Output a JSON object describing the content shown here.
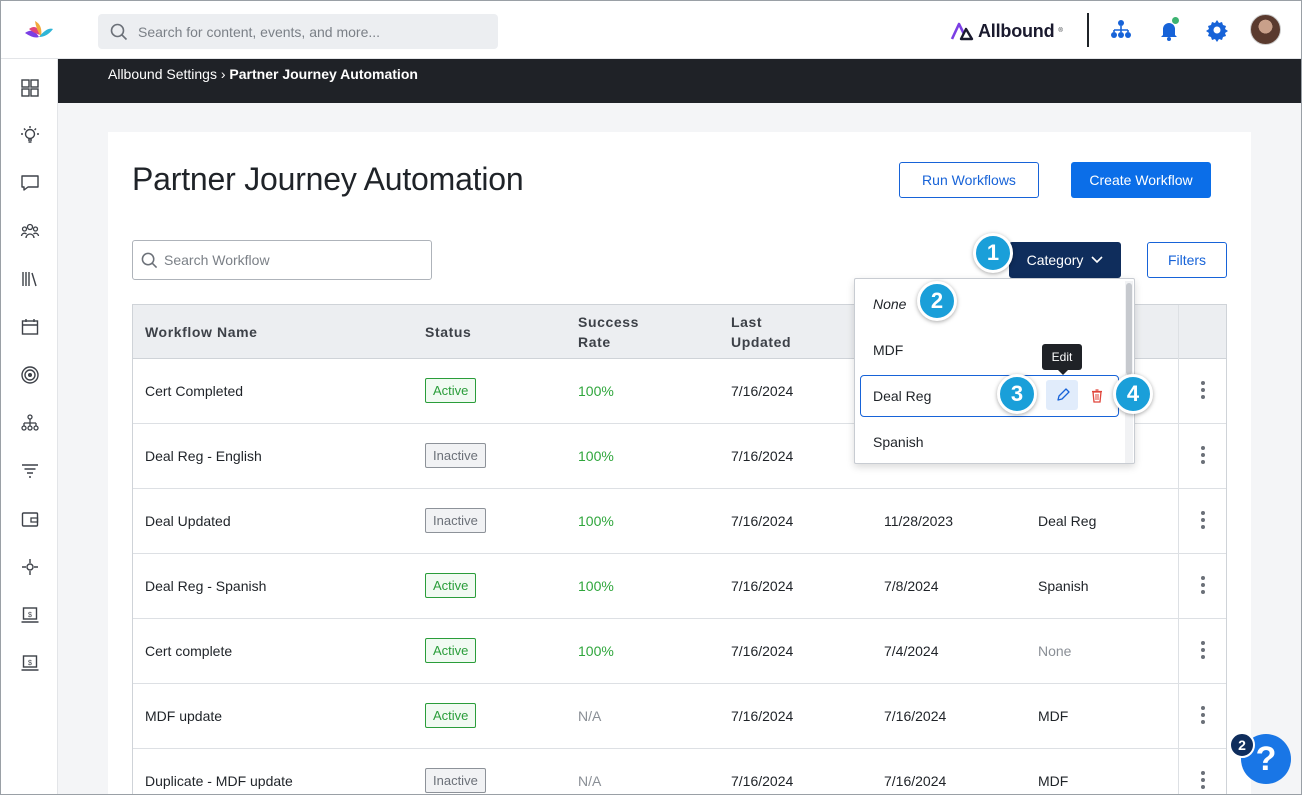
{
  "topbar": {
    "search_placeholder": "Search for content, events, and more...",
    "brand_name": "Allbound",
    "brand_reg": "®"
  },
  "breadcrumb": {
    "parent": "Allbound Settings",
    "separator": "›",
    "current": "Partner Journey Automation"
  },
  "page": {
    "title": "Partner Journey Automation",
    "run_workflows_label": "Run Workflows",
    "create_workflow_label": "Create Workflow",
    "search_placeholder": "Search Workflow",
    "category_label": "Category",
    "filters_label": "Filters"
  },
  "table": {
    "headers": {
      "name": "Workflow Name",
      "status": "Status",
      "success_1": "Success",
      "success_2": "Rate",
      "last_1": "Last",
      "last_2": "Updated"
    },
    "rows": [
      {
        "name": "Cert Completed",
        "status": "Active",
        "rate": "100%",
        "updated": "7/16/2024",
        "created": "",
        "category": ""
      },
      {
        "name": "Deal Reg - English",
        "status": "Inactive",
        "rate": "100%",
        "updated": "7/16/2024",
        "created": "",
        "category": ""
      },
      {
        "name": "Deal Updated",
        "status": "Inactive",
        "rate": "100%",
        "updated": "7/16/2024",
        "created": "11/28/2023",
        "category": "Deal Reg"
      },
      {
        "name": "Deal Reg - Spanish",
        "status": "Active",
        "rate": "100%",
        "updated": "7/16/2024",
        "created": "7/8/2024",
        "category": "Spanish"
      },
      {
        "name": "Cert complete",
        "status": "Active",
        "rate": "100%",
        "updated": "7/16/2024",
        "created": "7/4/2024",
        "category": "None"
      },
      {
        "name": "MDF update",
        "status": "Active",
        "rate": "N/A",
        "updated": "7/16/2024",
        "created": "7/16/2024",
        "category": "MDF"
      },
      {
        "name": "Duplicate - MDF update",
        "status": "Inactive",
        "rate": "N/A",
        "updated": "7/16/2024",
        "created": "7/16/2024",
        "category": "MDF"
      }
    ]
  },
  "dropdown": {
    "items": [
      "None",
      "MDF",
      "Deal Reg",
      "Spanish"
    ],
    "tooltip": "Edit"
  },
  "markers": [
    "1",
    "2",
    "3",
    "4"
  ],
  "help": {
    "icon": "?",
    "badge": "2"
  },
  "colors": {
    "primary": "#0b6ee8",
    "navy": "#0f2d5c",
    "active_green": "#2a9d3a",
    "callout": "#1a9fd9",
    "delete_red": "#e0453a"
  }
}
